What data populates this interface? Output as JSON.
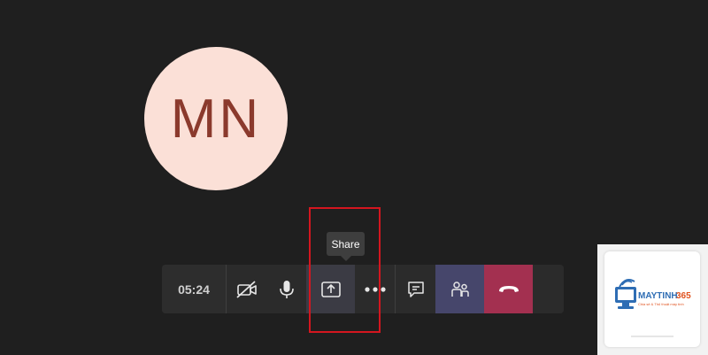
{
  "participant": {
    "initials": "MN",
    "avatar_color": "#fbe0d7",
    "text_color": "#8b3a2d"
  },
  "toolbar": {
    "timer": "05:24",
    "buttons": [
      {
        "name": "camera-off",
        "icon": "video-off-icon"
      },
      {
        "name": "mic",
        "icon": "microphone-icon"
      },
      {
        "name": "share",
        "icon": "share-screen-icon"
      },
      {
        "name": "more",
        "icon": "more-options-icon"
      },
      {
        "name": "chat",
        "icon": "chat-icon"
      },
      {
        "name": "participants",
        "icon": "people-icon"
      },
      {
        "name": "hang-up",
        "icon": "phone-hangup-icon"
      }
    ]
  },
  "tooltip": {
    "text": "Share"
  },
  "colors": {
    "background": "#1f1f1f",
    "hangup": "#a33050",
    "participants_active": "#46466b",
    "highlight": "#d4161f"
  },
  "watermark": {
    "brand": "MAYTINH365",
    "tagline": "Chia sẻ & Thủ thuật máy tính"
  }
}
